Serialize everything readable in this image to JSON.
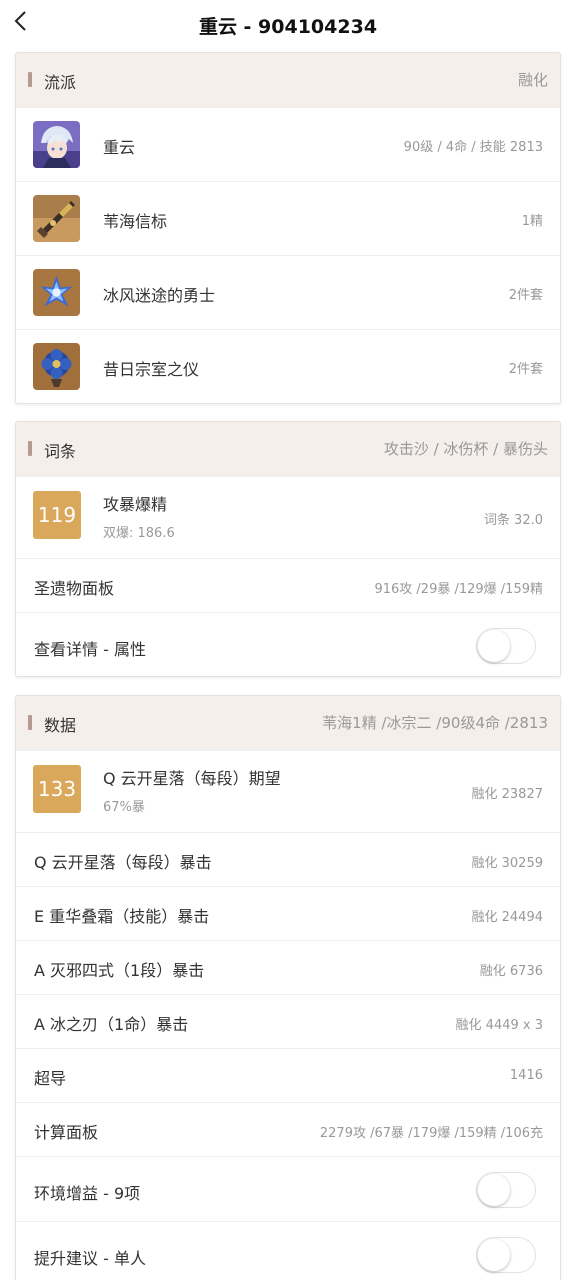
{
  "header": {
    "title": "重云 - 904104234"
  },
  "build": {
    "title": "流派",
    "right": "融化",
    "items": [
      {
        "name": "重云",
        "value": "90级 / 4命 / 技能 2813",
        "icon": "character-avatar-icon"
      },
      {
        "name": "苇海信标",
        "value": "1精",
        "icon": "weapon-icon"
      },
      {
        "name": "冰风迷途的勇士",
        "value": "2件套",
        "icon": "artifact-set-icon"
      },
      {
        "name": "昔日宗室之仪",
        "value": "2件套",
        "icon": "artifact-set-icon"
      }
    ]
  },
  "stats": {
    "title": "词条",
    "right": "攻击沙 / 冰伤杯 / 暴伤头",
    "score": "119",
    "score_title": "攻暴爆精",
    "score_sub": "双爆: 186.6",
    "score_value": "词条 32.0",
    "panel_label": "圣遗物面板",
    "panel_value": "916攻 /29暴 /129爆 /159精",
    "detail_label": "查看详情 - 属性",
    "detail_on": false
  },
  "data": {
    "title": "数据",
    "right": "苇海1精 /冰宗二 /90级4命 /2813",
    "score": "133",
    "score_title": "Q 云开星落（每段）期望",
    "score_sub": "67%暴",
    "score_value": "融化 23827",
    "rows": [
      {
        "label": "Q 云开星落（每段）暴击",
        "value": "融化 30259"
      },
      {
        "label": "E 重华叠霜（技能）暴击",
        "value": "融化 24494"
      },
      {
        "label": "A 灭邪四式（1段）暴击",
        "value": "融化 6736"
      },
      {
        "label": "A 冰之刃（1命）暴击",
        "value": "融化 4449 x 3"
      },
      {
        "label": "超导",
        "value": "1416"
      },
      {
        "label": "计算面板",
        "value": "2279攻 /67暴 /179爆 /159精 /106充"
      }
    ],
    "env_label": "环境增益 - 9项",
    "env_on": false,
    "advice_label": "提升建议 - 单人",
    "advice_on": false
  },
  "colors": {
    "badge": "#d9a85a",
    "header_bg": "#f5efec",
    "accent_bar": "#b59a91"
  }
}
